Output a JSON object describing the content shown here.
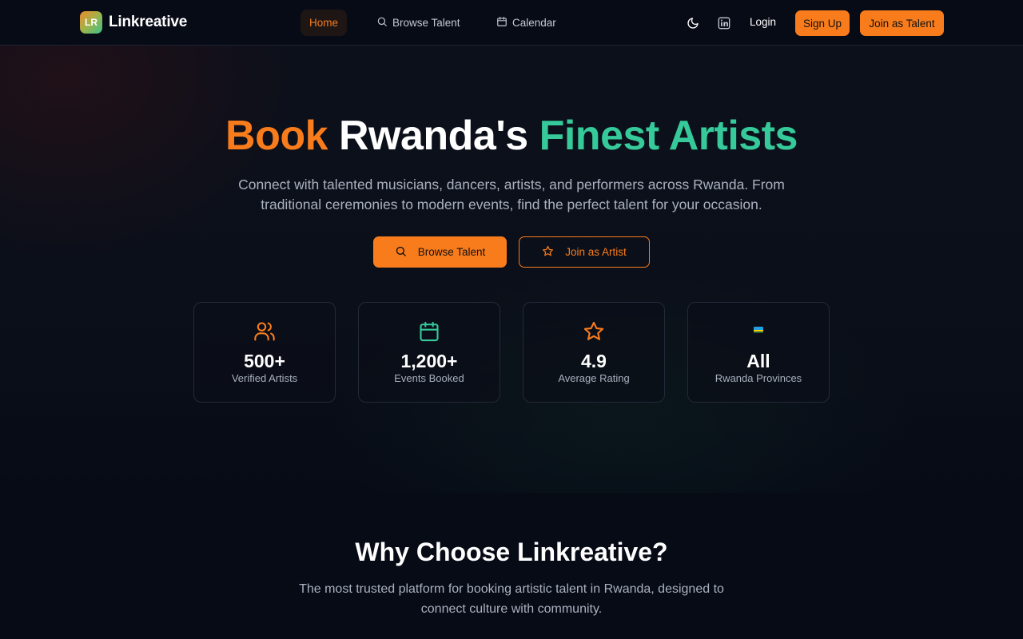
{
  "brand": {
    "badge": "LR",
    "name": "Linkreative"
  },
  "nav": {
    "home": "Home",
    "browse": "Browse Talent",
    "calendar": "Calendar",
    "login": "Login",
    "signup": "Sign Up",
    "join_talent": "Join as Talent"
  },
  "hero": {
    "title_word1": "Book",
    "title_word2": "Rwanda's",
    "title_word3": "Finest Artists",
    "subtitle": "Connect with talented musicians, dancers, artists, and performers across Rwanda. From traditional ceremonies to modern events, find the perfect talent for your occasion.",
    "browse_button": "Browse Talent",
    "join_button": "Join as Artist"
  },
  "stats": [
    {
      "icon": "users-icon",
      "value": "500+",
      "label": "Verified Artists"
    },
    {
      "icon": "calendar-icon",
      "value": "1,200+",
      "label": "Events Booked"
    },
    {
      "icon": "star-icon",
      "value": "4.9",
      "label": "Average Rating"
    },
    {
      "icon": "rwanda-flag-icon",
      "value": "All",
      "label": "Rwanda Provinces"
    }
  ],
  "why": {
    "title": "Why Choose Linkreative?",
    "subtitle": "The most trusted platform for booking artistic talent in Rwanda, designed to connect culture with community."
  },
  "colors": {
    "accent_orange": "#f97c1c",
    "accent_green": "#36c99a",
    "background": "#070b16"
  }
}
